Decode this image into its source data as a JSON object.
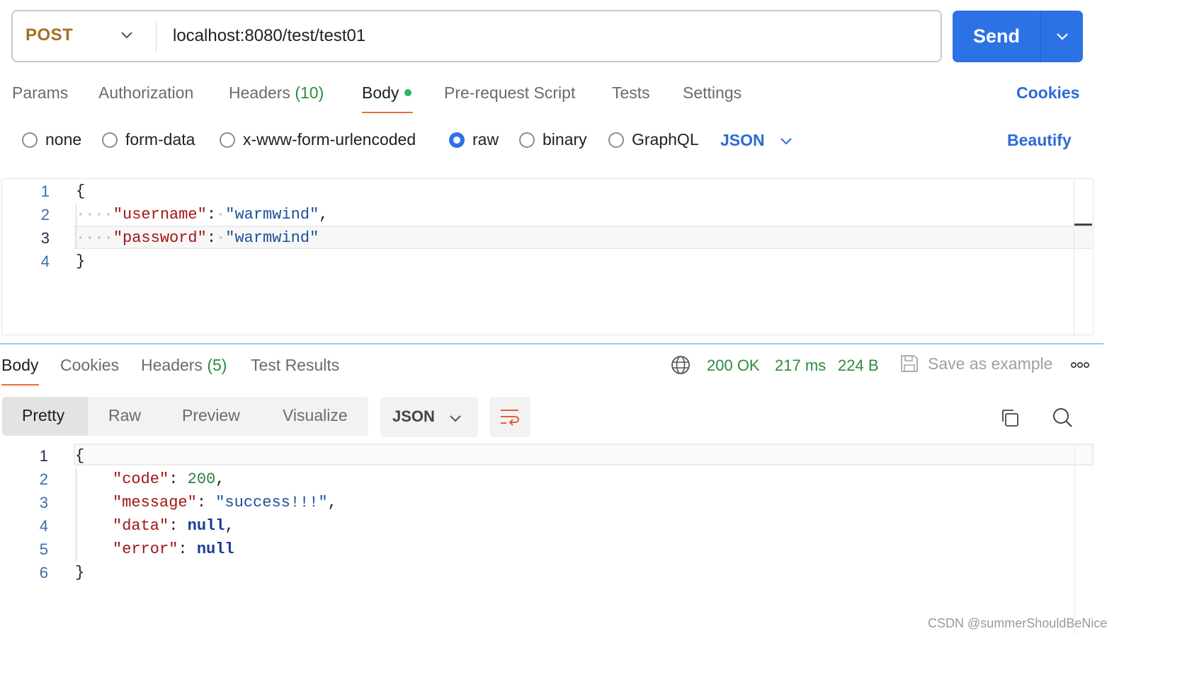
{
  "request": {
    "method": "POST",
    "url": "localhost:8080/test/test01",
    "send_label": "Send"
  },
  "request_tabs": {
    "params": "Params",
    "authorization": "Authorization",
    "headers": "Headers",
    "headers_count": "(10)",
    "body": "Body",
    "pre_request": "Pre-request Script",
    "tests": "Tests",
    "settings": "Settings",
    "cookies": "Cookies"
  },
  "body_modes": {
    "none": "none",
    "form_data": "form-data",
    "urlencoded": "x-www-form-urlencoded",
    "raw": "raw",
    "binary": "binary",
    "graphql": "GraphQL",
    "selected": "raw",
    "format": "JSON",
    "beautify": "Beautify"
  },
  "request_body": {
    "line_numbers": [
      "1",
      "2",
      "3",
      "4"
    ],
    "open": "{",
    "close": "}",
    "username_key": "\"username\"",
    "username_value": "\"warmwind\"",
    "password_key": "\"password\"",
    "password_value": "\"warmwind\""
  },
  "response_tabs": {
    "body": "Body",
    "cookies": "Cookies",
    "headers": "Headers",
    "headers_count": "(5)",
    "test_results": "Test Results",
    "status": "200 OK",
    "time": "217 ms",
    "size": "224 B",
    "save_example": "Save as example"
  },
  "response_view": {
    "pretty": "Pretty",
    "raw": "Raw",
    "preview": "Preview",
    "visualize": "Visualize",
    "format": "JSON"
  },
  "response_body": {
    "line_numbers": [
      "1",
      "2",
      "3",
      "4",
      "5",
      "6"
    ],
    "open": "{",
    "close": "}",
    "code_key": "\"code\"",
    "code_value": "200",
    "message_key": "\"message\"",
    "message_value": "\"success!!!\"",
    "data_key": "\"data\"",
    "data_value": "null",
    "error_key": "\"error\"",
    "error_value": "null"
  },
  "watermark": "CSDN @summerShouldBeNice",
  "colors": {
    "accent": "#2d72e5",
    "tab_underline": "#f26b3a",
    "method": "#a2711d",
    "status_green": "#2e8b3d",
    "link_blue": "#2d6ad6"
  }
}
